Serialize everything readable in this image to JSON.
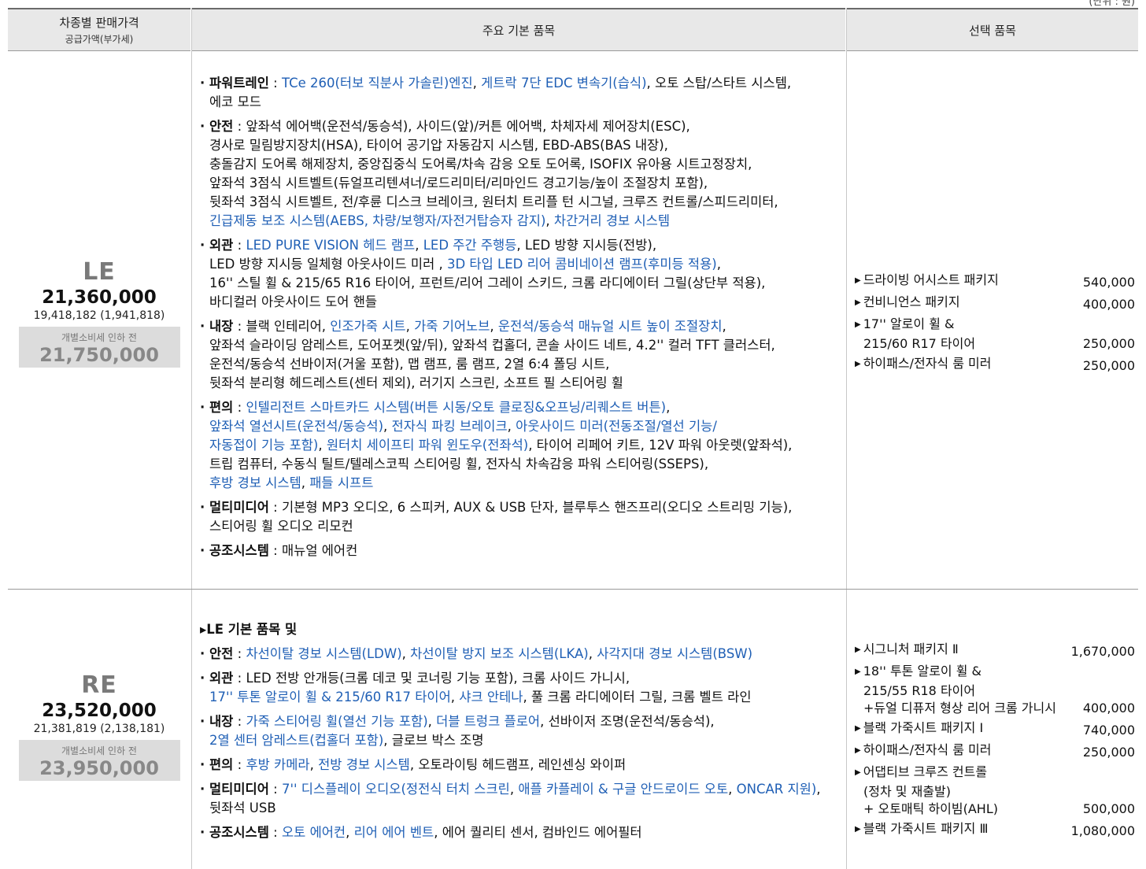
{
  "header": {
    "col1_title": "차종별 판매가격",
    "col1_sub": "공급가액(부가세)",
    "col2_title": "주요 기본 품목",
    "col3_title": "선택 품목",
    "top_cut_text": "(단위 : 원)"
  },
  "le": {
    "name": "LE",
    "price": "21,360,000",
    "supply": "19,418,182 (1,941,818)",
    "before_label": "개별소비세 인하 전",
    "before_price": "21,750,000",
    "specs": [
      {
        "label": "파워트레인",
        "segs": [
          {
            "t": "TCe 260(터보 직분사 가솔린)엔진",
            "b": true
          },
          {
            "t": ", "
          },
          {
            "t": "게트락 7단 EDC 변속기(습식)",
            "b": true
          },
          {
            "t": ", 오토 스탑/스타트 시스템,\n에코 모드"
          }
        ]
      },
      {
        "label": "안전",
        "segs": [
          {
            "t": "앞좌석 에어백(운전석/동승석), 사이드(앞)/커튼 에어백, 차체자세 제어장치(ESC),\n경사로 밀림방지장치(HSA), 타이어 공기압 자동감지 시스템, EBD-ABS(BAS 내장),\n충돌감지 도어록 해제장치, 중앙집중식 도어록/차속 감응 오토 도어록, ISOFIX 유아용 시트고정장치,\n앞좌석 3점식 시트벨트(듀얼프리텐셔너/로드리미터/리마인드 경고기능/높이 조절장치 포함),\n뒷좌석 3점식 시트벨트, 전/후륜 디스크 브레이크, 원터치 트리플 턴 시그널, 크루즈 컨트롤/스피드리미터,\n"
          },
          {
            "t": "긴급제동 보조 시스템(AEBS, 차량/보행자/자전거탑승자 감지)",
            "b": true
          },
          {
            "t": ", "
          },
          {
            "t": "차간거리 경보 시스템",
            "b": true
          }
        ]
      },
      {
        "label": "외관",
        "segs": [
          {
            "t": "LED PURE VISION 헤드 램프",
            "b": true
          },
          {
            "t": ", "
          },
          {
            "t": "LED 주간 주행등",
            "b": true
          },
          {
            "t": ", LED 방향 지시등(전방),\nLED 방향 지시등 일체형 아웃사이드 미러 , "
          },
          {
            "t": "3D 타입 LED 리어 콤비네이션 램프(후미등 적용)",
            "b": true
          },
          {
            "t": ",\n16'' 스틸 휠 & 215/65 R16 타이어, 프런트/리어 그레이 스키드, 크롬 라디에이터 그릴(상단부 적용),\n바디컬러 아웃사이드 도어 핸들"
          }
        ]
      },
      {
        "label": "내장",
        "segs": [
          {
            "t": "블랙 인테리어, "
          },
          {
            "t": "인조가죽 시트",
            "b": true
          },
          {
            "t": ", "
          },
          {
            "t": "가죽 기어노브",
            "b": true
          },
          {
            "t": ", "
          },
          {
            "t": "운전석/동승석 매뉴얼 시트 높이 조절장치",
            "b": true
          },
          {
            "t": ",\n앞좌석 슬라이딩 암레스트, 도어포켓(앞/뒤), 앞좌석 컵홀더, 콘솔 사이드 네트, 4.2'' 컬러 TFT 클러스터,\n운전석/동승석 선바이저(거울 포함), 맵 램프, 룸 램프, 2열 6:4 폴딩 시트,\n뒷좌석 분리형 헤드레스트(센터 제외), 러기지 스크린, 소프트 필 스티어링 휠"
          }
        ]
      },
      {
        "label": "편의",
        "segs": [
          {
            "t": "인텔리전트 스마트카드 시스템(버튼 시동/오토 클로징&오프닝/리퀘스트 버튼)",
            "b": true
          },
          {
            "t": ",\n"
          },
          {
            "t": "앞좌석 열선시트(운전석/동승석)",
            "b": true
          },
          {
            "t": ", "
          },
          {
            "t": "전자식 파킹 브레이크",
            "b": true
          },
          {
            "t": ", "
          },
          {
            "t": "아웃사이드 미러(전동조절/열선 기능/\n자동접이 기능 포함)",
            "b": true
          },
          {
            "t": ", "
          },
          {
            "t": "원터치 세이프티 파워 윈도우(전좌석)",
            "b": true
          },
          {
            "t": ", 타이어 리페어 키트, 12V 파워 아웃렛(앞좌석),\n트립 컴퓨터, 수동식 틸트/텔레스코픽 스티어링 휠, 전자식 차속감응 파워 스티어링(SSEPS),\n"
          },
          {
            "t": "후방 경보 시스템",
            "b": true
          },
          {
            "t": ", "
          },
          {
            "t": "패들 시프트",
            "b": true
          }
        ]
      },
      {
        "label": "멀티미디어",
        "segs": [
          {
            "t": "기본형 MP3 오디오, 6 스피커, AUX & USB 단자, 블루투스 핸즈프리(오디오 스트리밍 기능),\n스티어링 휠 오디오 리모컨"
          }
        ]
      },
      {
        "label": "공조시스템",
        "segs": [
          {
            "t": "매뉴얼 에어컨"
          }
        ]
      }
    ],
    "options": [
      {
        "name": "드라이빙 어시스트 패키지",
        "price": "540,000"
      },
      {
        "name": "컨비니언스 패키지",
        "price": "400,000"
      },
      {
        "name": "17'' 알로이 휠 &\n215/60 R17 타이어",
        "price": "250,000"
      },
      {
        "name": "하이패스/전자식 룸 미러",
        "price": "250,000"
      }
    ]
  },
  "re": {
    "name": "RE",
    "price": "23,520,000",
    "supply": "21,381,819 (2,138,181)",
    "before_label": "개별소비세 인하 전",
    "before_price": "23,950,000",
    "intro": "▸LE 기본 품목 및",
    "specs": [
      {
        "label": "안전",
        "segs": [
          {
            "t": "차선이탈 경보 시스템(LDW)",
            "b": true
          },
          {
            "t": ", "
          },
          {
            "t": "차선이탈 방지 보조 시스템(LKA)",
            "b": true
          },
          {
            "t": ", "
          },
          {
            "t": "사각지대 경보 시스템(BSW)",
            "b": true
          }
        ]
      },
      {
        "label": "외관",
        "segs": [
          {
            "t": "LED 전방 안개등(크롬 데코 및 코너링 기능 포함), 크롬 사이드 가니시,\n"
          },
          {
            "t": "17'' 투톤 알로이 휠 & 215/60 R17 타이어",
            "b": true
          },
          {
            "t": ", "
          },
          {
            "t": "샤크 안테나",
            "b": true
          },
          {
            "t": ", 풀 크롬 라디에이터 그릴, 크롬 벨트 라인"
          }
        ]
      },
      {
        "label": "내장",
        "segs": [
          {
            "t": "가죽 스티어링 휠(열선 기능 포함)",
            "b": true
          },
          {
            "t": ", "
          },
          {
            "t": "더블 트렁크 플로어",
            "b": true
          },
          {
            "t": ", 선바이저 조명(운전석/동승석),\n"
          },
          {
            "t": "2열 센터 암레스트(컵홀더 포함)",
            "b": true
          },
          {
            "t": ", 글로브 박스 조명"
          }
        ]
      },
      {
        "label": "편의",
        "segs": [
          {
            "t": "후방 카메라",
            "b": true
          },
          {
            "t": ", "
          },
          {
            "t": "전방 경보 시스템",
            "b": true
          },
          {
            "t": ", 오토라이팅 헤드램프, 레인센싱 와이퍼"
          }
        ]
      },
      {
        "label": "멀티미디어",
        "segs": [
          {
            "t": "7'' 디스플레이 오디오(정전식 터치 스크린",
            "b": true
          },
          {
            "t": ", "
          },
          {
            "t": "애플 카플레이 & 구글 안드로이드 오토",
            "b": true
          },
          {
            "t": ", "
          },
          {
            "t": "ONCAR 지원)",
            "b": true
          },
          {
            "t": ",\n뒷좌석 USB"
          }
        ]
      },
      {
        "label": "공조시스템",
        "segs": [
          {
            "t": "오토 에어컨",
            "b": true
          },
          {
            "t": ", "
          },
          {
            "t": "리어 에어 벤트",
            "b": true
          },
          {
            "t": ", 에어 퀄리티 센서, 컴바인드 에어필터"
          }
        ]
      }
    ],
    "options": [
      {
        "name": "시그니처 패키지 Ⅱ",
        "price": "1,670,000"
      },
      {
        "name": "18'' 투톤 알로이 휠 &\n215/55 R18 타이어\n+듀얼 디퓨저 형상 리어 크롬 가니시",
        "price": "400,000"
      },
      {
        "name": "블랙 가죽시트 패키지 Ⅰ",
        "price": "740,000"
      },
      {
        "name": "하이패스/전자식 룸 미러",
        "price": "250,000"
      },
      {
        "name": "어댑티브 크루즈 컨트롤\n(정차 및 재출발)\n+ 오토매틱 하이빔(AHL)",
        "price": "500,000"
      },
      {
        "name": "블랙 가죽시트 패키지 Ⅲ",
        "price": "1,080,000"
      }
    ]
  },
  "colors": {
    "highlight": "#1f5fb5",
    "header_bg": "#e8e8e8",
    "before_bg": "#dcdcdc"
  }
}
